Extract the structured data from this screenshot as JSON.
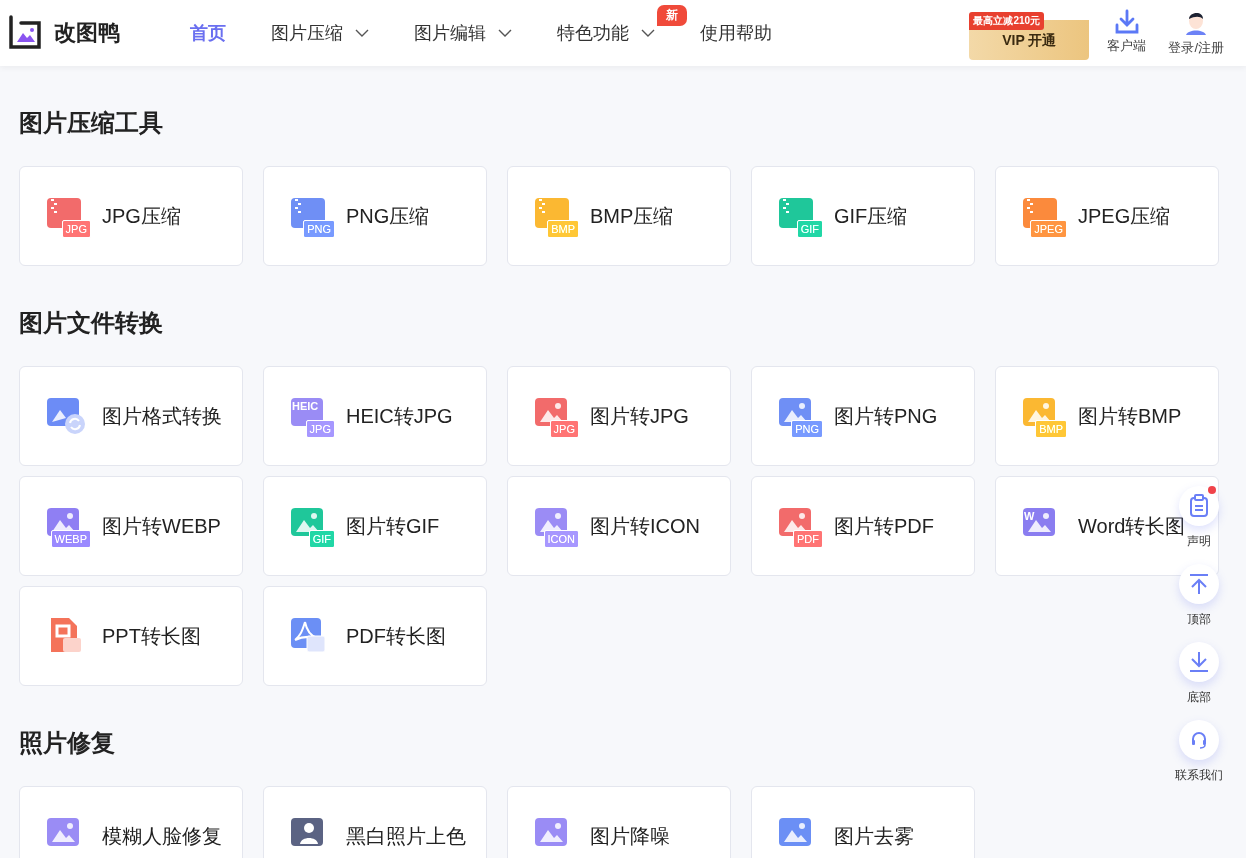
{
  "header": {
    "logo_text": "改图鸭",
    "nav": [
      {
        "label": "首页",
        "selected": true,
        "has_dropdown": false
      },
      {
        "label": "图片压缩",
        "selected": false,
        "has_dropdown": true
      },
      {
        "label": "图片编辑",
        "selected": false,
        "has_dropdown": true
      },
      {
        "label": "特色功能",
        "selected": false,
        "has_dropdown": true,
        "badge": "新"
      },
      {
        "label": "使用帮助",
        "selected": false,
        "has_dropdown": false
      }
    ],
    "vip": {
      "label": "VIP 开通",
      "promo": "最高立减210元"
    },
    "actions": [
      {
        "kind": "download",
        "label": "客户端"
      },
      {
        "kind": "avatar",
        "label": "登录/注册"
      }
    ]
  },
  "sections": [
    {
      "title": "图片压缩工具",
      "tools": [
        {
          "label": "JPG压缩",
          "kind": "zip",
          "badge": "JPG",
          "color": "#f26b6b"
        },
        {
          "label": "PNG压缩",
          "kind": "zip",
          "badge": "PNG",
          "color": "#6f8ff5"
        },
        {
          "label": "BMP压缩",
          "kind": "zip",
          "badge": "BMP",
          "color": "#fbb832"
        },
        {
          "label": "GIF压缩",
          "kind": "zip",
          "badge": "GIF",
          "color": "#1fc79a"
        },
        {
          "label": "JPEG压缩",
          "kind": "zip",
          "badge": "JPEG",
          "color": "#fb8a3c"
        }
      ]
    },
    {
      "title": "图片文件转换",
      "tools": [
        {
          "label": "图片格式转换",
          "kind": "convert",
          "color": "#6c8cf6"
        },
        {
          "label": "HEIC转JPG",
          "kind": "heic",
          "badge": "JPG",
          "top_badge": "HEIC",
          "color": "#9a8cf5"
        },
        {
          "label": "图片转JPG",
          "kind": "image",
          "badge": "JPG",
          "color": "#f26b6b"
        },
        {
          "label": "图片转PNG",
          "kind": "image",
          "badge": "PNG",
          "color": "#6f8ff5"
        },
        {
          "label": "图片转BMP",
          "kind": "image",
          "badge": "BMP",
          "color": "#fbb832"
        },
        {
          "label": "图片转WEBP",
          "kind": "image",
          "badge": "WEBP",
          "color": "#8f7ff3"
        },
        {
          "label": "图片转GIF",
          "kind": "image",
          "badge": "GIF",
          "color": "#1fc79a"
        },
        {
          "label": "图片转ICON",
          "kind": "image",
          "badge": "ICON",
          "color": "#9b8cf5"
        },
        {
          "label": "图片转PDF",
          "kind": "image",
          "badge": "PDF",
          "color": "#f26b6b"
        },
        {
          "label": "Word转长图",
          "kind": "word",
          "top_badge": "W",
          "color": "#8a7df0"
        },
        {
          "label": "PPT转长图",
          "kind": "ppt",
          "color": "#f4735a"
        },
        {
          "label": "PDF转长图",
          "kind": "pdf",
          "color": "#6b8ff5"
        }
      ]
    },
    {
      "title": "照片修复",
      "tools": [
        {
          "label": "模糊人脸修复",
          "kind": "face",
          "color": "#9a8cf5"
        },
        {
          "label": "黑白照片上色",
          "kind": "portrait",
          "color": "#5b6383"
        },
        {
          "label": "图片降噪",
          "kind": "image",
          "color": "#9a8cf5"
        },
        {
          "label": "图片去雾",
          "kind": "image",
          "color": "#6b8ff5"
        }
      ]
    }
  ],
  "float_bar": [
    {
      "kind": "notice",
      "label": "声明",
      "unread": true
    },
    {
      "kind": "top",
      "label": "顶部",
      "unread": false
    },
    {
      "kind": "bottom",
      "label": "底部",
      "unread": false
    },
    {
      "kind": "support",
      "label": "联系我们",
      "unread": false
    }
  ]
}
